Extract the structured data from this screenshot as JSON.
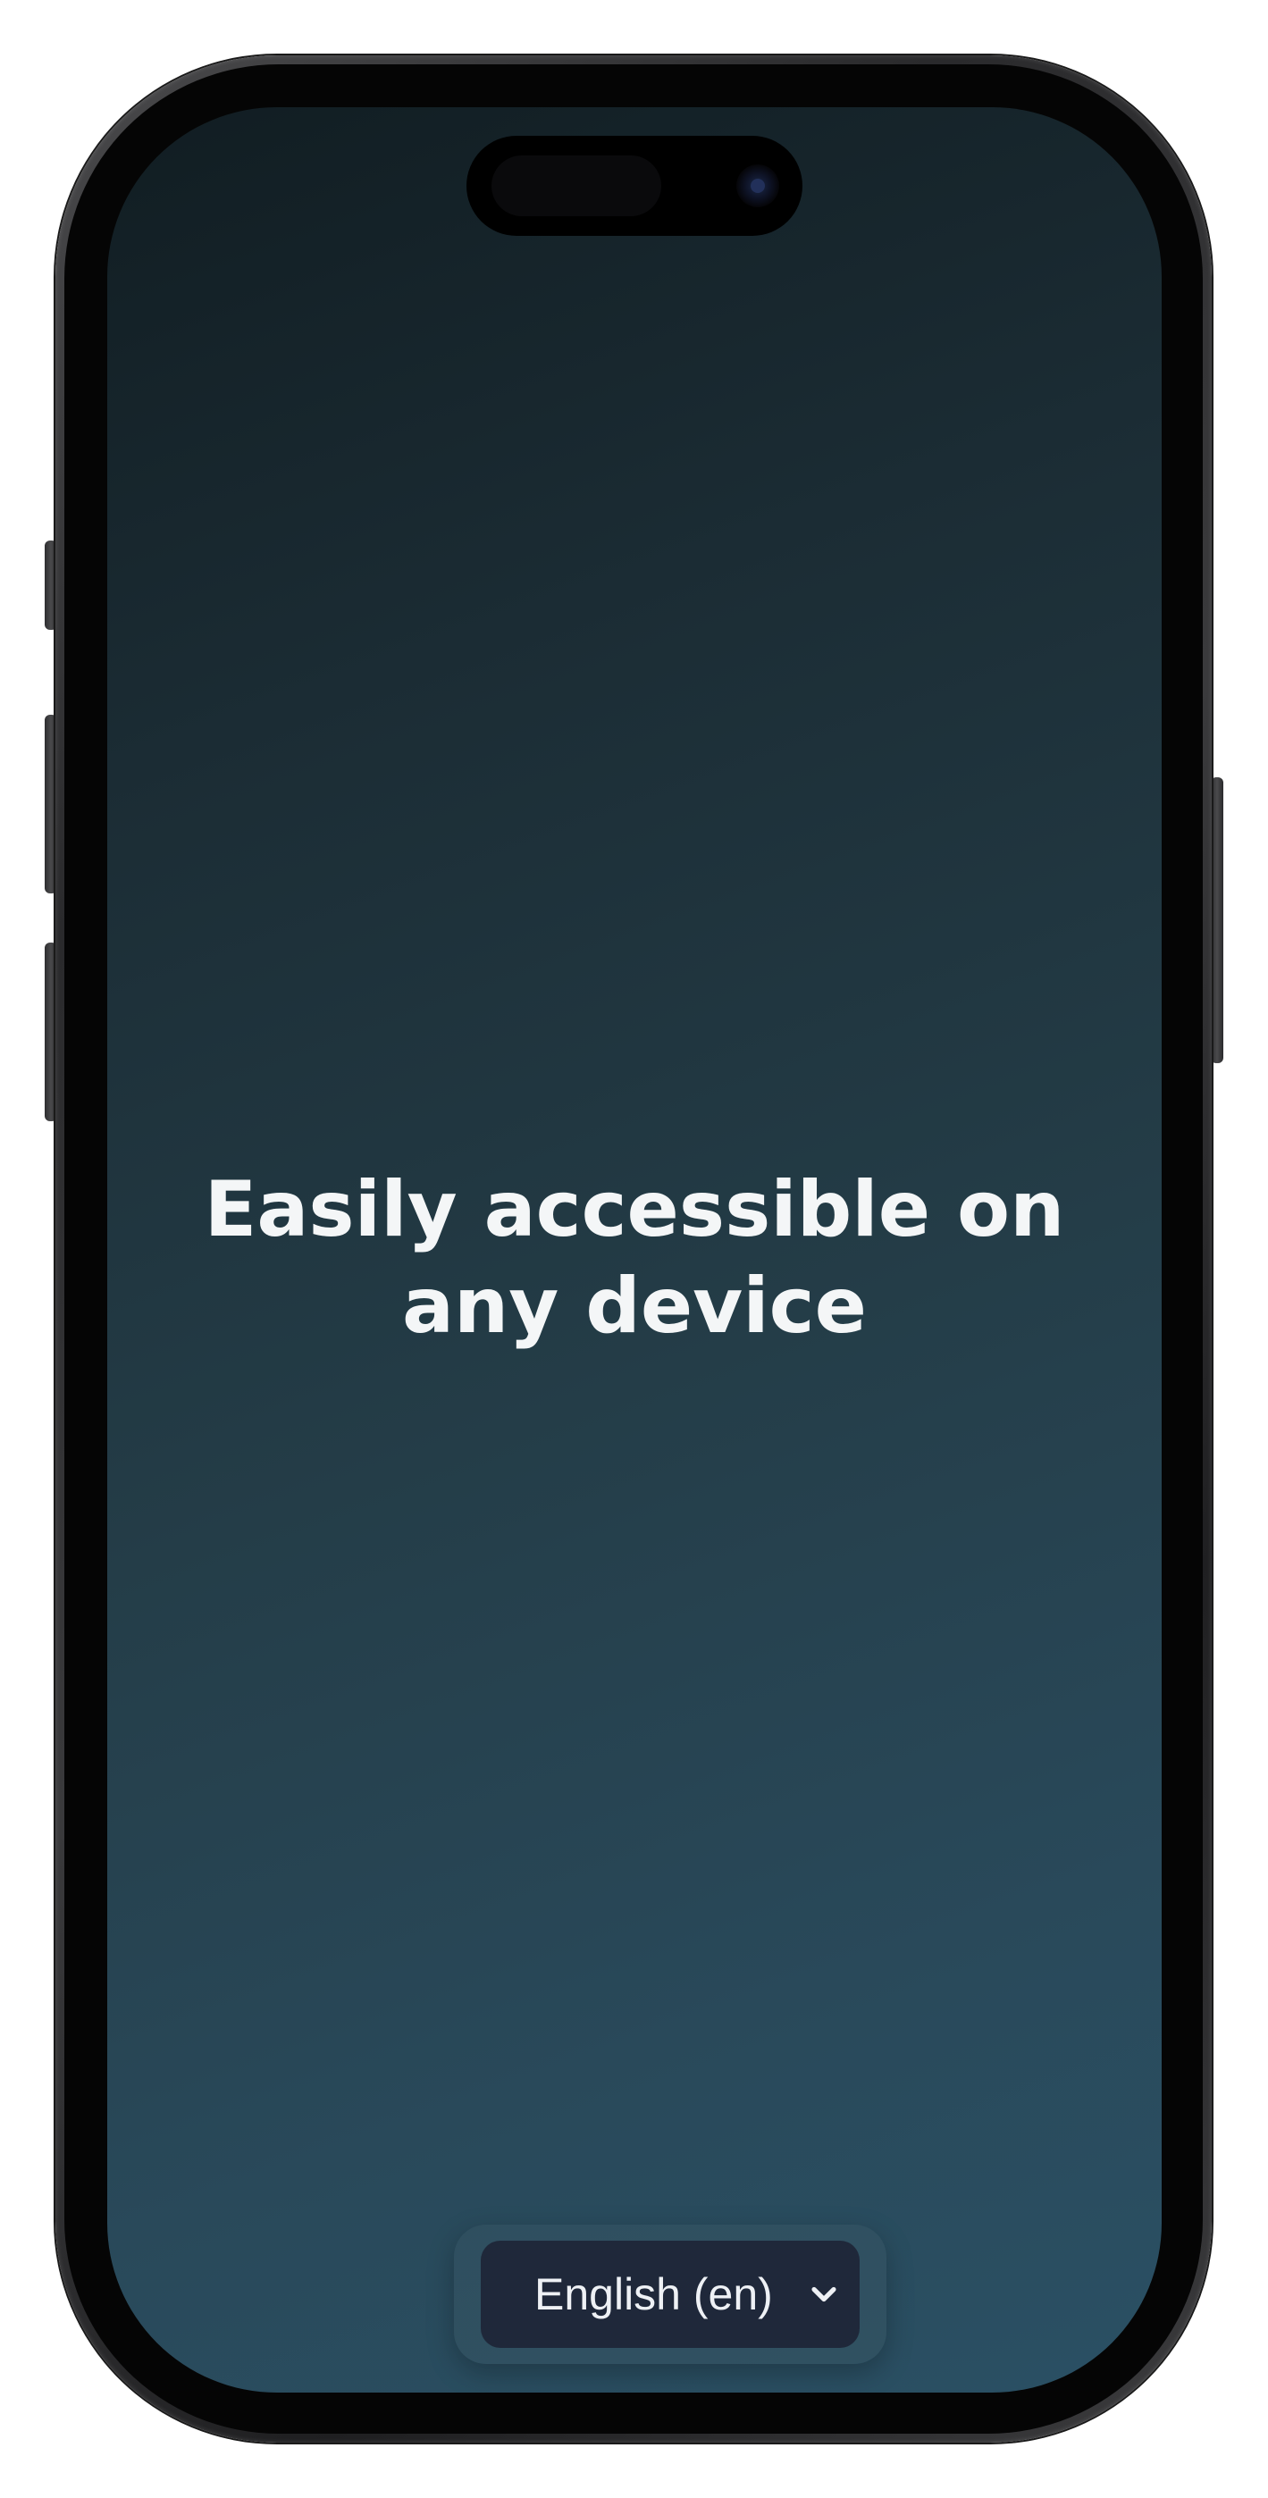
{
  "screen": {
    "headline_line1": "Easily accessible on",
    "headline_line2": "any device"
  },
  "language_selector": {
    "selected": "English (en)",
    "icon": "chevron-down-icon"
  },
  "colors": {
    "background_top": "#111d22",
    "background_bottom": "#2a5064",
    "select_bg": "#1f283a",
    "text": "#f4f6f7"
  }
}
